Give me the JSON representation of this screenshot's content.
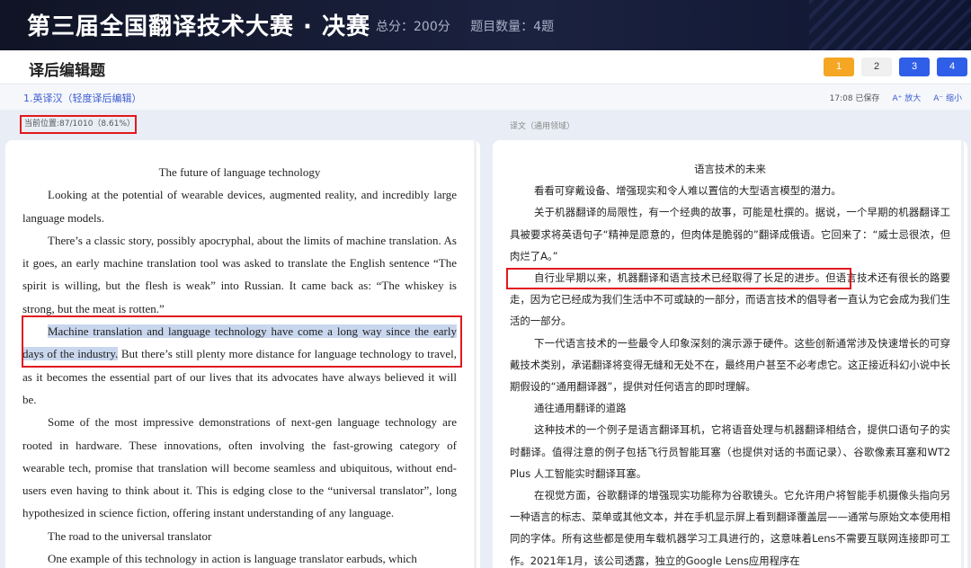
{
  "topbar": {
    "title": "第三届全国翻译技术大赛 · 决赛",
    "total_score": "总分：200分",
    "question_count": "题目数量：4题"
  },
  "header": {
    "title": "译后编辑题",
    "pages": [
      "1",
      "2",
      "3",
      "4"
    ]
  },
  "subbar": {
    "task": "1.英译汉（轻度译后编辑）",
    "saved": "17:08 已保存",
    "zoom_in": "A⁺ 放大",
    "zoom_out": "A⁻ 缩小"
  },
  "source": {
    "position": "当前位置:87/1010（8.61%）",
    "title": "The future of language technology",
    "p1": "Looking at the potential of wearable devices, augmented reality, and incredibly large language models.",
    "p2": "There’s a classic story, possibly apocryphal, about the limits of machine translation. As it goes, an early machine translation tool was asked to translate the English sentence “The spirit is willing, but the flesh is weak” into Russian. It came back as: “The whiskey is strong, but the meat is rotten.”",
    "p3_highlight": "Machine translation and language technology have come a long way since the early days of the industry.",
    "p3_rest": " But there’s still plenty more distance for language technology to travel, as it becomes the essential part of our lives that its advocates have always believed it will be.",
    "p4": "Some of the most impressive demonstrations of next-gen language technology are rooted in hardware. These innovations, often involving the fast-growing category of wearable tech, promise that translation will become seamless and ubiquitous, without end-users even having to think about it. This is edging close to the “universal translator”, long hypothesized in science fiction, offering instant understanding of any language.",
    "p5": "The road to the universal translator",
    "p6": "One example of this technology in action is language translator earbuds, which"
  },
  "target": {
    "label": "译文（通用领域）",
    "title": "语言技术的未来",
    "p1": "看看可穿戴设备、增强现实和令人难以置信的大型语言模型的潜力。",
    "p2": "关于机器翻译的局限性，有一个经典的故事，可能是杜撰的。据说，一个早期的机器翻译工具被要求将英语句子“精神是愿意的，但肉体是脆弱的”翻译成俄语。它回来了：“威士忌很浓，但肉烂了A。”",
    "p3_a": "自行业早期以来，机器翻译和语言技术已经取得了长足的进步。",
    "p3_b": "但语言技术还有很长的路要走，因为它已经成为我们生活中不可或缺的一部分，而语言技术的倡导者一直认为它会成为我们生活的一部分。",
    "p4": "下一代语言技术的一些最令人印象深刻的演示源于硬件。这些创新通常涉及快速增长的可穿戴技术类别，承诺翻译将变得无缝和无处不在，最终用户甚至不必考虑它。这正接近科幻小说中长期假设的“通用翻译器”，提供对任何语言的即时理解。",
    "p5": "通往通用翻译的道路",
    "p6": "这种技术的一个例子是语言翻译耳机，它将语音处理与机器翻译相结合，提供口语句子的实时翻译。值得注意的例子包括飞行员智能耳塞（也提供对话的书面记录）、谷歌像素耳塞和WT2 Plus 人工智能实时翻译耳塞。",
    "p7": "在视觉方面，谷歌翻译的增强现实功能称为谷歌镜头。它允许用户将智能手机摄像头指向另一种语言的标志、菜单或其他文本，并在手机显示屏上看到翻译覆盖层——通常与原始文本使用相同的字体。所有这些都是使用车载机器学习工具进行的，这意味着Lens不需要互联网连接即可工作。2021年1月，该公司透露，独立的Google Lens应用程序在"
  },
  "colors": {
    "accent_blue": "#2f5ee8",
    "accent_orange": "#f5a623",
    "mark_red": "#e0191e",
    "highlight": "#c9d7ee"
  }
}
